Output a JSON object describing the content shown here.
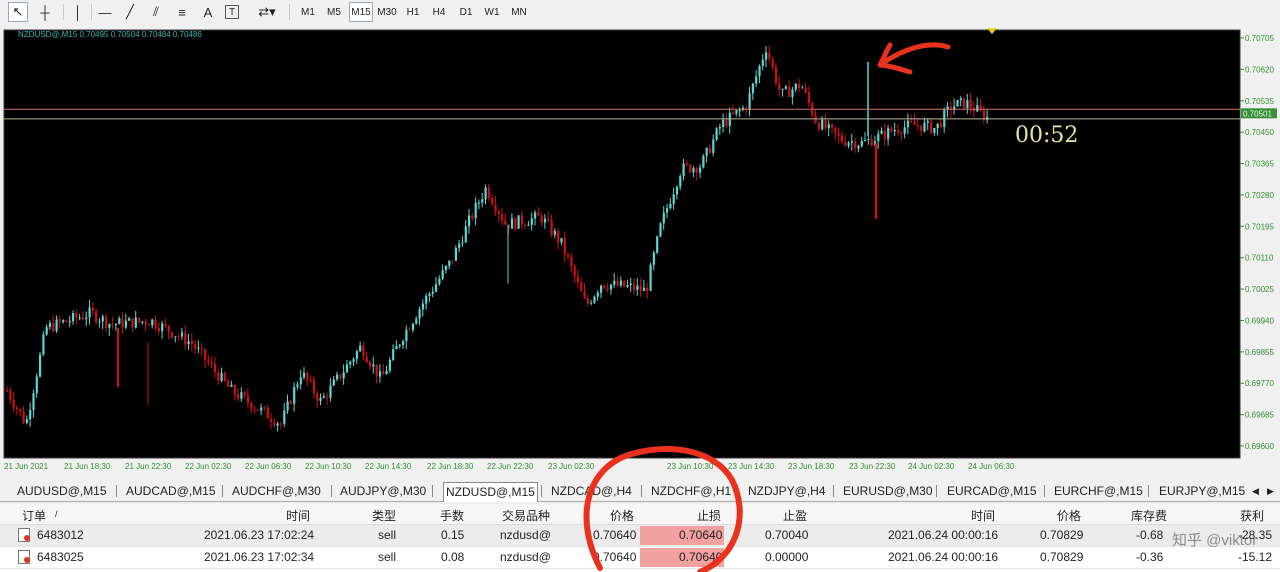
{
  "toolbar": {
    "icons": [
      "cursor-icon",
      "crosshair-icon",
      "vertical-line-icon",
      "horizontal-line-icon",
      "trendline-icon",
      "channel-icon",
      "fibonacci-icon",
      "text-icon",
      "text-label-icon",
      "arrows-icon"
    ],
    "timeframes": [
      "M1",
      "M5",
      "M15",
      "M30",
      "H1",
      "H4",
      "D1",
      "W1",
      "MN"
    ],
    "active_timeframe": "M15",
    "text_tool": "A",
    "label_tool": "T"
  },
  "chart": {
    "info": "NZDUSD@,M15  0.70495 0.70504 0.70484 0.70486",
    "timer": "00:52",
    "bid_label": "0.70501",
    "price_labels": [
      "0.70705",
      "0.70620",
      "0.70535",
      "0.70450",
      "0.70365",
      "0.70280",
      "0.70195",
      "0.70110",
      "0.70025",
      "0.69940",
      "0.69855",
      "0.69770",
      "0.69685",
      "0.69600"
    ],
    "time_labels": [
      "21 Jun 2021",
      "21 Jun 18:30",
      "21 Jun 22:30",
      "22 Jun 02:30",
      "22 Jun 06:30",
      "22 Jun 10:30",
      "22 Jun 14:30",
      "22 Jun 18:30",
      "22 Jun 22:30",
      "23 Jun 02:30",
      "23 Jun 10:30",
      "23 Jun 14:30",
      "23 Jun 18:30",
      "23 Jun 22:30",
      "24 Jun 02:30",
      "24 Jun 06:30"
    ],
    "colors": {
      "background": "#000000",
      "bull": "#5fd4d4",
      "bear": "#cc1111",
      "grid_text": "#2f8f2f",
      "ask_line": "#d07070",
      "bid_line": "#b8b89a"
    }
  },
  "tabs": {
    "items": [
      "AUDUSD@,M15",
      "AUDCAD@,M15",
      "AUDCHF@,M30",
      "AUDJPY@,M30",
      "NZDUSD@,M15",
      "NZDCAD@,H4",
      "NZDCHF@,H1",
      "NZDJPY@,H4",
      "EURUSD@,M30",
      "EURCAD@,M15",
      "EURCHF@,M15",
      "EURJPY@,M15"
    ],
    "active": "NZDUSD@,M15",
    "scroll_left": "◀",
    "scroll_right": "▶"
  },
  "table": {
    "headers": {
      "order": "订单",
      "sort": "/",
      "time": "时间",
      "type": "类型",
      "lots": "手数",
      "symbol": "交易品种",
      "price": "价格",
      "sl": "止损",
      "tp": "止盈",
      "close_time": "时间",
      "close_price": "价格",
      "swap": "库存费",
      "profit": "获利"
    },
    "rows": [
      {
        "order": "6483012",
        "time": "2021.06.23 17:02:24",
        "type": "sell",
        "lots": "0.15",
        "symbol": "nzdusd@",
        "price": "0.70640",
        "sl": "0.70640",
        "tp": "0.70040",
        "close_time": "2021.06.24 00:00:16",
        "close_price": "0.70829",
        "swap": "-0.68",
        "profit": "-28.35"
      },
      {
        "order": "6483025",
        "time": "2021.06.23 17:02:34",
        "type": "sell",
        "lots": "0.08",
        "symbol": "nzdusd@",
        "price": "0.70640",
        "sl": "0.70640",
        "tp": "0.00000",
        "close_time": "2021.06.24 00:00:16",
        "close_price": "0.70829",
        "swap": "-0.36",
        "profit": "-15.12"
      }
    ]
  },
  "watermark": "知乎 @viktor",
  "annotation_color": "#e8321e"
}
